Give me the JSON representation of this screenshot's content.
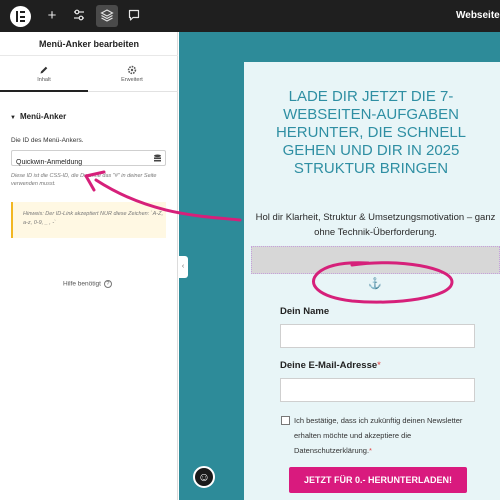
{
  "topbar": {
    "site_title": "Webseite Q",
    "colors": {
      "background": "#1f1f1f",
      "active": "#4a4a4a"
    },
    "buttons": [
      {
        "icon": "elementor-logo-icon"
      },
      {
        "icon": "plus-icon",
        "glyph": "+"
      },
      {
        "icon": "sliders-icon"
      },
      {
        "icon": "layers-icon",
        "active": true
      },
      {
        "icon": "comment-icon"
      }
    ]
  },
  "panel": {
    "title": "Menü-Anker bearbeiten",
    "tabs": [
      {
        "label": "Inhalt",
        "icon": "pencil-icon",
        "active": true
      },
      {
        "label": "Erweitert",
        "icon": "gear-icon",
        "active": false
      }
    ],
    "section": {
      "caret": "▼",
      "title": "Menü-Anker"
    },
    "field_label": "Die ID des Menü-Ankers.",
    "anchor_input_value": "Quickwin-Anmeldung",
    "help_text": "Diese ID ist die CSS-ID, die Du ohne das \"#\" in deiner Seite verwenden musst.",
    "notice": "Hinweis: Der ID-Link akzeptiert NUR diese Zeichen: `A-Z, a-z, 0-9, _ , -`",
    "help_link": "Hilfe benötigt",
    "help_link_icon": "question-icon",
    "collapse_glyph": "‹"
  },
  "page": {
    "headline": "LADE DIR JETZT DIE 7-WEBSEITEN-AUFGABEN HERUNTER, DIE SCHNELL GEHEN UND DIR IN 2025 STRUKTUR BRINGEN",
    "subline": "Hol dir Klarheit, Struktur &  Umsetzungsmotivation – ganz ohne Technik-Überforderung.",
    "anchor_glyph": "⚓",
    "form": {
      "name_label": "Dein Name",
      "email_label": "Deine E-Mail-Adresse",
      "required_mark": "*",
      "consent": "Ich bestätige, dass ich zukünftig deinen Newsletter erhalten möchte und akzeptiere die Datenschutzerklärung.",
      "required_mark_consent": "*",
      "cta": "JETZT FÜR 0.- HERUNTERLADEN!"
    },
    "a11y_glyph": "☺",
    "colors": {
      "canvas_bg": "#2d8b99",
      "card_bg": "#e8f5f7",
      "headline": "#2f8fa3",
      "cta_bg": "#d91a7e",
      "annotation": "#d6207a"
    }
  }
}
